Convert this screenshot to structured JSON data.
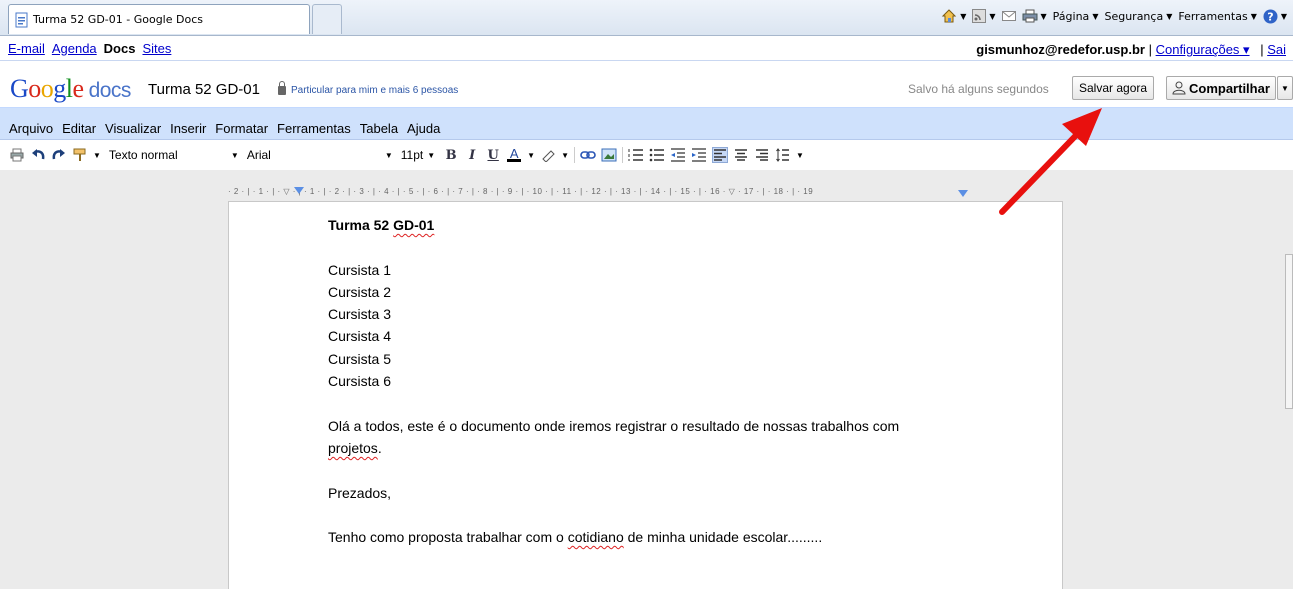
{
  "browser": {
    "tab_title": "Turma 52 GD-01 - Google Docs",
    "commands": [
      {
        "label": "Página"
      },
      {
        "label": "Segurança"
      },
      {
        "label": "Ferramentas"
      }
    ]
  },
  "gbar": {
    "links": [
      "E-mail",
      "Agenda",
      "Docs",
      "Sites"
    ],
    "current": "Docs",
    "user": "gismunhoz@redefor.usp.br",
    "sep": "|",
    "settings": "Configurações ▾",
    "signout": "Sai"
  },
  "header": {
    "logo_docs": "docs",
    "doc_title": "Turma 52 GD-01",
    "privacy": "Particular para mim e mais 6 pessoas",
    "saved_status": "Salvo há alguns segundos",
    "save_button": "Salvar agora",
    "share_button": "Compartilhar"
  },
  "menu": [
    "Arquivo",
    "Editar",
    "Visualizar",
    "Inserir",
    "Formatar",
    "Ferramentas",
    "Tabela",
    "Ajuda"
  ],
  "toolbar": {
    "style": "Texto normal",
    "font": "Arial",
    "size": "11pt",
    "bold": "B",
    "italic": "I",
    "underline": "U",
    "text_color": "A"
  },
  "ruler": "· 2 · | · 1 · | · ▽ · | · 1 · | · 2 · | · 3 · | · 4 · | · 5 · | · 6 · | · 7 · | · 8 · | · 9 · | · 10 · | · 11 · | · 12 · | · 13 · | · 14 · | · 15 · | · 16 · ▽ · 17 · | · 18 · | · 19",
  "document": {
    "heading": "Turma 52 GD-01",
    "students": [
      "Cursista 1",
      "Cursista 2",
      "Cursista 3",
      "Cursista 4",
      "Cursista 5",
      "Cursista 6"
    ],
    "para1_line1": "Olá a todos, este é o documento  onde iremos registrar o resultado de nossas trabalhos com",
    "para1_line2": "projetos",
    "para1_end": ".",
    "greeting": "Prezados,",
    "para2_start": "Tenho como proposta trabalhar com o ",
    "para2_word": "cotidiano",
    "para2_end": " de minha unidade escolar........."
  },
  "colors": {
    "arrow": "#e8100e",
    "menubar": "#cfe1fc"
  }
}
